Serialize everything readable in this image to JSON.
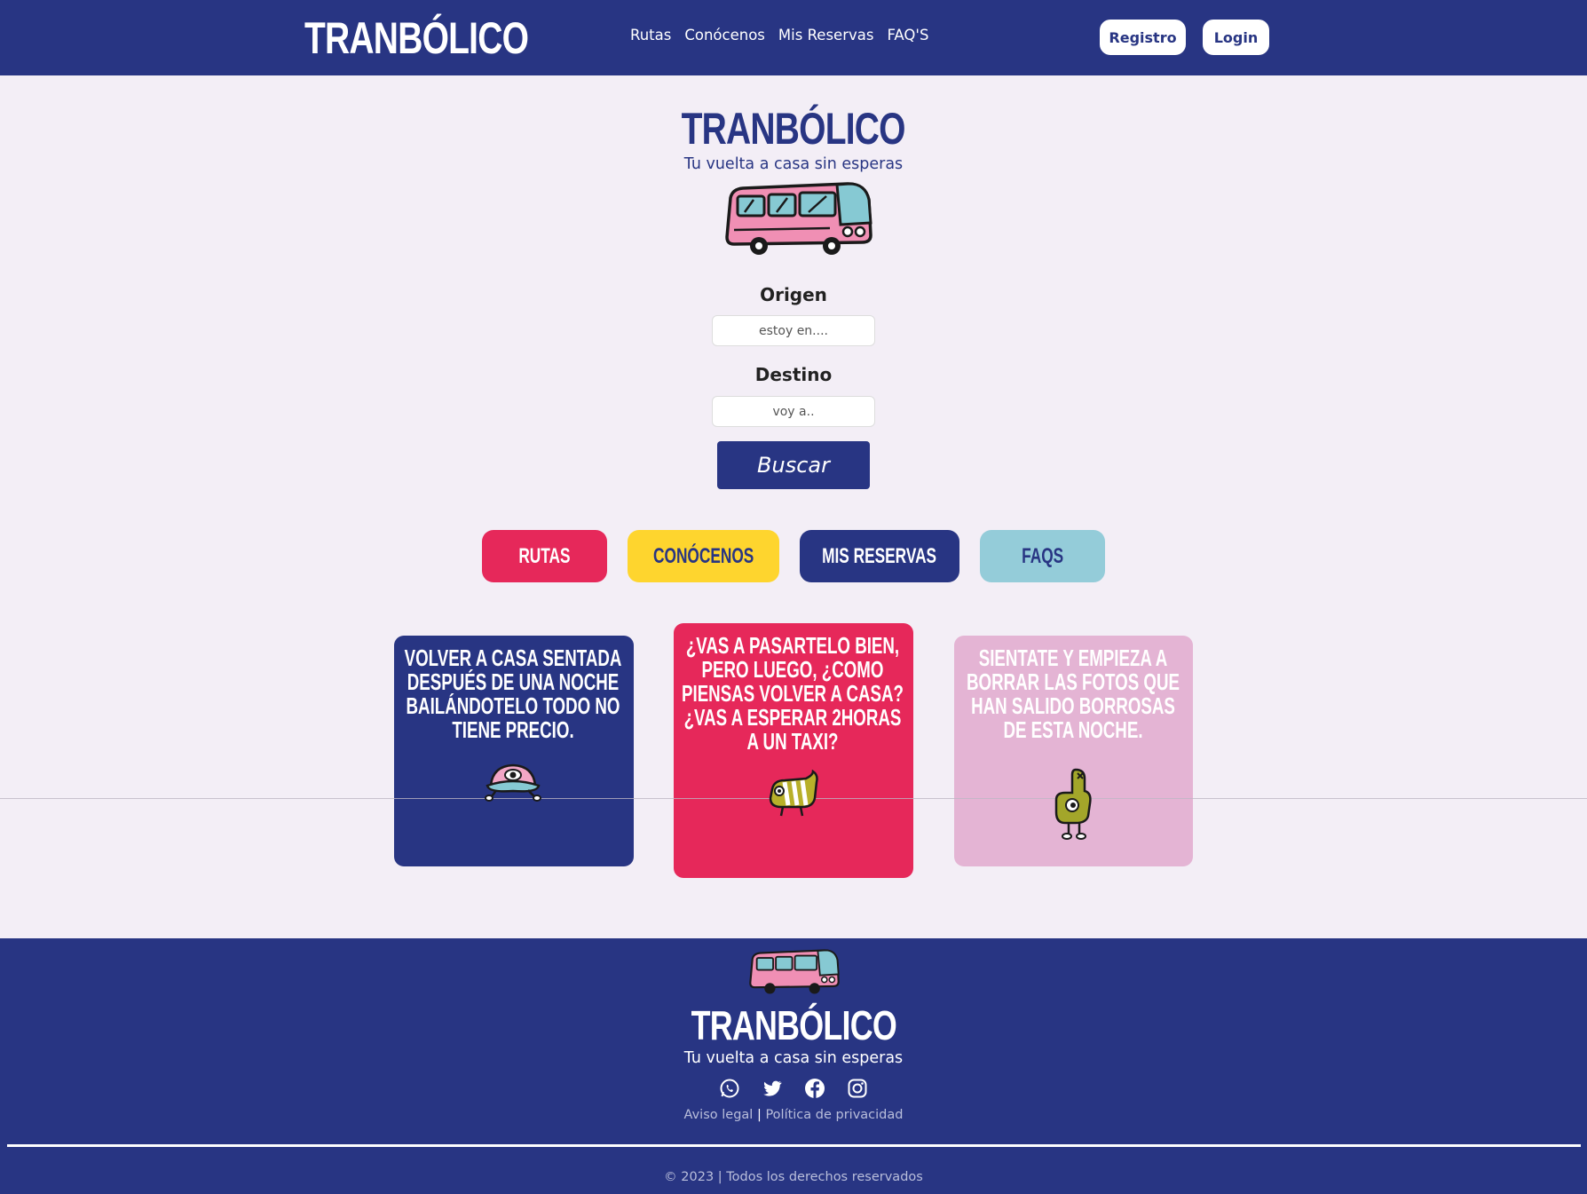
{
  "brand": {
    "name": "TRANBÓLICO",
    "tagline": "Tu vuelta a casa sin esperas"
  },
  "nav": {
    "links": [
      "Rutas",
      "Conócenos",
      "Mis Reservas",
      "FAQ'S"
    ],
    "registro": "Registro",
    "login": "Login"
  },
  "search": {
    "origen_label": "Origen",
    "origen_placeholder": "estoy en....",
    "destino_label": "Destino",
    "destino_placeholder": "voy a..",
    "button": "Buscar"
  },
  "pills": [
    "RUTAS",
    "CONÓCENOS",
    "MIS RESERVAS",
    "FAQS"
  ],
  "cards": [
    "Volver a casa sentada después de una noche bailándotelo todo no tiene precio.",
    "¿Vas a pasartelo bien, pero luego, ¿como piensas volver a casa? ¿Vas a esperar 2horas a un taxi?",
    "Sientate y empieza a borrar las fotos que han salido borrosas de esta noche."
  ],
  "footer": {
    "aviso": "Aviso legal",
    "separator": "|",
    "privacidad": "Política de privacidad",
    "copyright": "© 2023 | Todos los derechos reservados",
    "social_icons": [
      "whatsapp-icon",
      "twitter-icon",
      "facebook-icon",
      "instagram-icon"
    ]
  },
  "colors": {
    "navy": "#283583",
    "pink": "#e6285a",
    "yellow": "#fed52e",
    "light_blue": "#94ccd9",
    "light_pink": "#e4b4d4",
    "background": "#f3eef6"
  }
}
